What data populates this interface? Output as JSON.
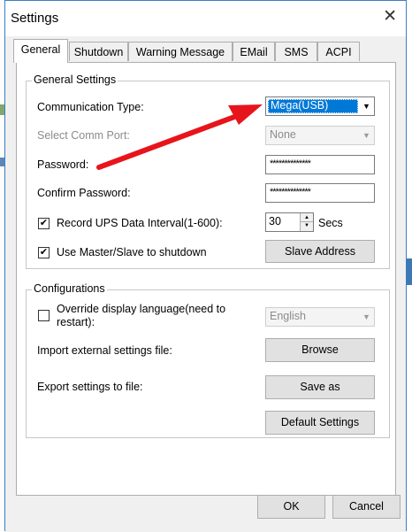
{
  "window": {
    "title": "Settings"
  },
  "tabs": [
    {
      "label": "General"
    },
    {
      "label": "Shutdown"
    },
    {
      "label": "Warning Message"
    },
    {
      "label": "EMail"
    },
    {
      "label": "SMS"
    },
    {
      "label": "ACPI"
    }
  ],
  "general_settings": {
    "legend": "General Settings",
    "communication_type_label": "Communication Type:",
    "communication_type_value": "Mega(USB)",
    "comm_port_label": "Select Comm Port:",
    "comm_port_value": "None",
    "password_label": "Password:",
    "password_value": "**************",
    "confirm_password_label": "Confirm Password:",
    "confirm_password_value": "**************",
    "record_interval_label": "Record UPS Data Interval(1-600):",
    "record_interval_checked": true,
    "record_interval_value": "30",
    "record_interval_unit": "Secs",
    "master_slave_label": "Use Master/Slave to shutdown",
    "master_slave_checked": true,
    "slave_address_button": "Slave Address"
  },
  "configurations": {
    "legend": "Configurations",
    "override_language_label": "Override display language(need to restart):",
    "override_language_checked": false,
    "language_value": "English",
    "import_label": "Import external settings file:",
    "browse_button": "Browse",
    "export_label": "Export settings to file:",
    "save_as_button": "Save as",
    "default_settings_button": "Default Settings"
  },
  "footer": {
    "ok_button": "OK",
    "cancel_button": "Cancel"
  },
  "colors": {
    "selection": "#0078d7",
    "annotation_arrow": "#e8141b",
    "window_border": "#3c7fc1"
  }
}
